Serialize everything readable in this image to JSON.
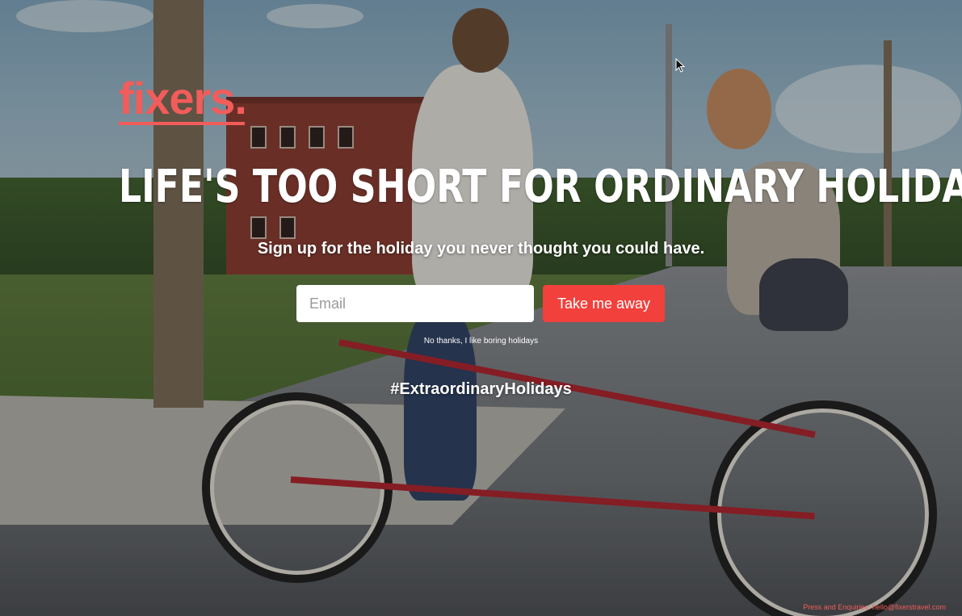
{
  "brand": {
    "logo_text": "fixers.",
    "accent_color": "#f25c5a"
  },
  "hero": {
    "headline": "LIFE'S TOO SHORT FOR ORDINARY HOLIDAYS",
    "subhead": "Sign up for the holiday you never thought you could have.",
    "hashtag": "#ExtraordinaryHolidays",
    "background_icon": "photo-background"
  },
  "signup": {
    "email_placeholder": "Email",
    "email_value": "",
    "submit_label": "Take me away",
    "submit_color": "#f2403c",
    "decline_label": "No thanks, I like boring holidays"
  },
  "footer": {
    "contact_text": "Press and Enquiries: hello@fixerstravel.com"
  },
  "cursor": {
    "icon": "mouse-pointer-icon"
  }
}
